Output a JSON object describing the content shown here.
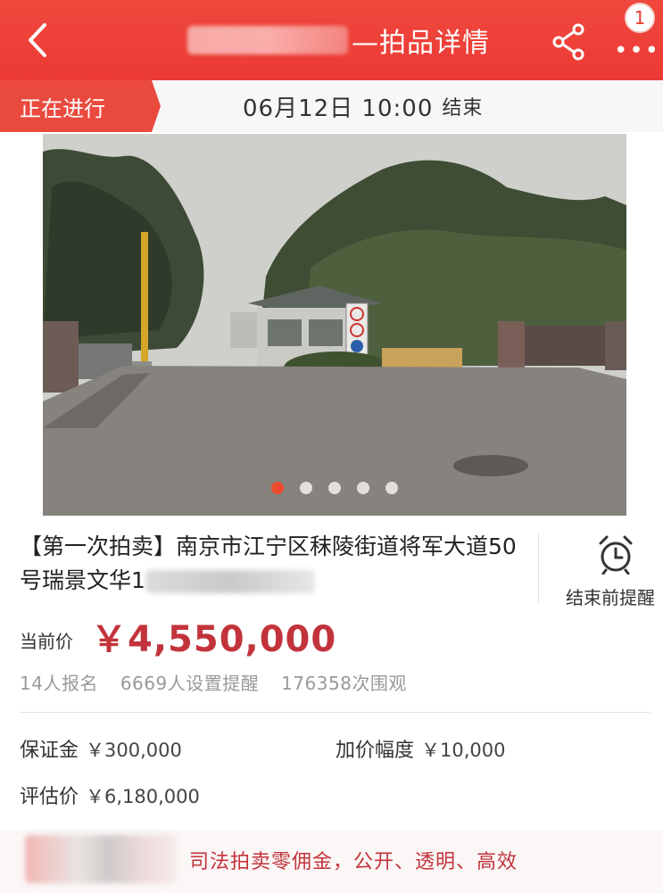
{
  "header": {
    "title_suffix": "—拍品详情",
    "badge_count": "1",
    "brand_color": "#eb3a35"
  },
  "status": {
    "tag": "正在进行",
    "end_time": "06月12日 10:00",
    "end_label": "结束"
  },
  "gallery": {
    "image_count": 5,
    "active_index": 0
  },
  "item": {
    "title_line": "【第一次拍卖】南京市江宁区秣陵街道将军大道50号瑞景文华1",
    "reminder_label": "结束前提醒"
  },
  "price": {
    "label": "当前价",
    "value": "￥4,550,000"
  },
  "stats": {
    "signups": "14人报名",
    "reminders": "6669人设置提醒",
    "views": "176358次围观"
  },
  "details": {
    "deposit_label": "保证金",
    "deposit_value": "￥300,000",
    "increment_label": "加价幅度",
    "increment_value": "￥10,000",
    "appraisal_label": "评估价",
    "appraisal_value": "￥6,180,000"
  },
  "promo": {
    "text": "司法拍卖零佣金，公开、透明、高效"
  },
  "icons": {
    "back": "back-chevron-icon",
    "share": "share-icon",
    "more": "more-dots-icon",
    "clock": "alarm-clock-icon"
  }
}
